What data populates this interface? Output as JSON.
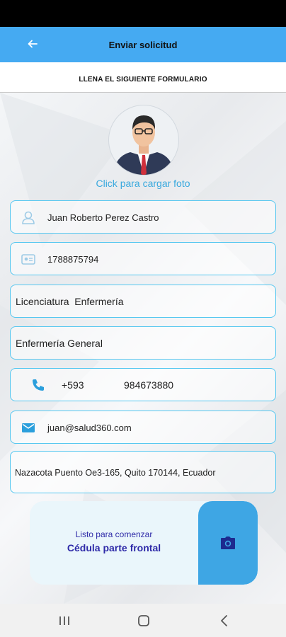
{
  "appbar": {
    "title": "Enviar solicitud",
    "back_icon": "arrow-left-icon",
    "color": "#45aaf2"
  },
  "form": {
    "heading": "LLENA EL SIGUIENTE FORMULARIO",
    "photo_link": "Click para cargar foto",
    "fields": {
      "name": "Juan Roberto Perez Castro",
      "id_number": "1788875794",
      "degree": "Licenciatura  Enfermería",
      "specialty": "Enfermería General",
      "phone_code": "+593",
      "phone_number": "984673880",
      "email": "juan@salud360.com",
      "address": "Nazacota Puento Oe3-165, Quito 170144, Ecuador"
    },
    "document": {
      "prompt": "Listo para comenzar",
      "type": "Cédula parte frontal",
      "icon": "camera-icon"
    }
  },
  "colors": {
    "accent": "#45aaf2",
    "field_border": "#55c7f0",
    "link": "#39a9de",
    "doc_text": "#2e2aa8"
  }
}
